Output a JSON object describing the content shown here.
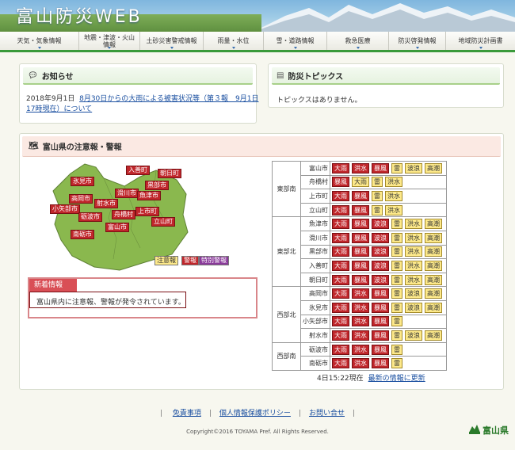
{
  "header": {
    "title": "富山防災WEB"
  },
  "nav": [
    {
      "label": "天気・気象情報"
    },
    {
      "label": "地震・津波・火山\n情報"
    },
    {
      "label": "土砂災害警戒情報"
    },
    {
      "label": "雨量・水位"
    },
    {
      "label": "雪・道路情報"
    },
    {
      "label": "救急医療"
    },
    {
      "label": "防災啓発情報"
    },
    {
      "label": "地域防災計画書"
    }
  ],
  "notice": {
    "title": "お知らせ",
    "date": "2018年9月1日",
    "link": "8月30日からの大雨による被害状況等（第３報　9月1日17時現在）について"
  },
  "topics": {
    "title": "防災トピックス",
    "text": "トピックスはありません。"
  },
  "warnings": {
    "title": "富山県の注意報・警報",
    "map_labels": [
      "入善町",
      "朝日町",
      "氷見市",
      "黒部市",
      "滑川市",
      "魚津市",
      "高岡市",
      "射水市",
      "小矢部市",
      "上市町",
      "舟橋村",
      "砺波市",
      "立山町",
      "富山市",
      "南砺市"
    ],
    "legend": [
      "注意報",
      "警報",
      "特別警報"
    ],
    "legend_colors": {
      "注意報": "#fde98a",
      "警報": "#c0262b",
      "特別警報": "#8a3a9a"
    },
    "new_info": {
      "title": "新着情報",
      "text": "富山県内に注意報、警報が発令されています。"
    },
    "table": [
      {
        "region": "東部南",
        "cities": [
          {
            "name": "富山市",
            "badges": [
              [
                "大雨",
                "r"
              ],
              [
                "洪水",
                "r"
              ],
              [
                "暴風",
                "r"
              ],
              [
                "雷",
                "y"
              ],
              [
                "波浪",
                "y"
              ],
              [
                "高潮",
                "y"
              ]
            ]
          },
          {
            "name": "舟橋村",
            "badges": [
              [
                "暴風",
                "r"
              ],
              [
                "大雨",
                "y"
              ],
              [
                "雷",
                "y"
              ],
              [
                "洪水",
                "y"
              ]
            ]
          },
          {
            "name": "上市町",
            "badges": [
              [
                "大雨",
                "r"
              ],
              [
                "暴風",
                "r"
              ],
              [
                "雷",
                "y"
              ],
              [
                "洪水",
                "y"
              ]
            ]
          },
          {
            "name": "立山町",
            "badges": [
              [
                "大雨",
                "r"
              ],
              [
                "暴風",
                "r"
              ],
              [
                "雷",
                "y"
              ],
              [
                "洪水",
                "y"
              ]
            ]
          }
        ]
      },
      {
        "region": "東部北",
        "cities": [
          {
            "name": "魚津市",
            "badges": [
              [
                "大雨",
                "r"
              ],
              [
                "暴風",
                "r"
              ],
              [
                "波浪",
                "r"
              ],
              [
                "雷",
                "y"
              ],
              [
                "洪水",
                "y"
              ],
              [
                "高潮",
                "y"
              ]
            ]
          },
          {
            "name": "滑川市",
            "badges": [
              [
                "大雨",
                "r"
              ],
              [
                "暴風",
                "r"
              ],
              [
                "波浪",
                "r"
              ],
              [
                "雷",
                "y"
              ],
              [
                "洪水",
                "y"
              ],
              [
                "高潮",
                "y"
              ]
            ]
          },
          {
            "name": "黒部市",
            "badges": [
              [
                "大雨",
                "r"
              ],
              [
                "暴風",
                "r"
              ],
              [
                "波浪",
                "r"
              ],
              [
                "雷",
                "y"
              ],
              [
                "洪水",
                "y"
              ],
              [
                "高潮",
                "y"
              ]
            ]
          },
          {
            "name": "入善町",
            "badges": [
              [
                "大雨",
                "r"
              ],
              [
                "暴風",
                "r"
              ],
              [
                "波浪",
                "r"
              ],
              [
                "雷",
                "y"
              ],
              [
                "洪水",
                "y"
              ],
              [
                "高潮",
                "y"
              ]
            ]
          },
          {
            "name": "朝日町",
            "badges": [
              [
                "大雨",
                "r"
              ],
              [
                "暴風",
                "r"
              ],
              [
                "波浪",
                "r"
              ],
              [
                "雷",
                "y"
              ],
              [
                "洪水",
                "y"
              ],
              [
                "高潮",
                "y"
              ]
            ]
          }
        ]
      },
      {
        "region": "西部北",
        "cities": [
          {
            "name": "高岡市",
            "badges": [
              [
                "大雨",
                "r"
              ],
              [
                "洪水",
                "r"
              ],
              [
                "暴風",
                "r"
              ],
              [
                "雷",
                "y"
              ],
              [
                "波浪",
                "y"
              ],
              [
                "高潮",
                "y"
              ]
            ]
          },
          {
            "name": "氷見市",
            "badges": [
              [
                "大雨",
                "r"
              ],
              [
                "洪水",
                "r"
              ],
              [
                "暴風",
                "r"
              ],
              [
                "雷",
                "y"
              ],
              [
                "波浪",
                "y"
              ],
              [
                "高潮",
                "y"
              ]
            ]
          },
          {
            "name": "小矢部市",
            "badges": [
              [
                "大雨",
                "r"
              ],
              [
                "洪水",
                "r"
              ],
              [
                "暴風",
                "r"
              ],
              [
                "雷",
                "y"
              ]
            ]
          },
          {
            "name": "射水市",
            "badges": [
              [
                "大雨",
                "r"
              ],
              [
                "洪水",
                "r"
              ],
              [
                "暴風",
                "r"
              ],
              [
                "雷",
                "y"
              ],
              [
                "波浪",
                "y"
              ],
              [
                "高潮",
                "y"
              ]
            ]
          }
        ]
      },
      {
        "region": "西部南",
        "cities": [
          {
            "name": "砺波市",
            "badges": [
              [
                "大雨",
                "r"
              ],
              [
                "洪水",
                "r"
              ],
              [
                "暴風",
                "r"
              ],
              [
                "雷",
                "y"
              ]
            ]
          },
          {
            "name": "南砺市",
            "badges": [
              [
                "大雨",
                "r"
              ],
              [
                "洪水",
                "r"
              ],
              [
                "暴風",
                "r"
              ],
              [
                "雷",
                "y"
              ]
            ]
          }
        ]
      }
    ],
    "updated": "4日15:22現在",
    "refresh_link": "最新の情報に更新"
  },
  "footer": {
    "links": [
      "免責事項",
      "個人情報保護ポリシー",
      "お問い合せ"
    ],
    "copyright": "Copyright©2016 TOYAMA Pref. All Rights Reserved.",
    "logo": "富山県"
  }
}
